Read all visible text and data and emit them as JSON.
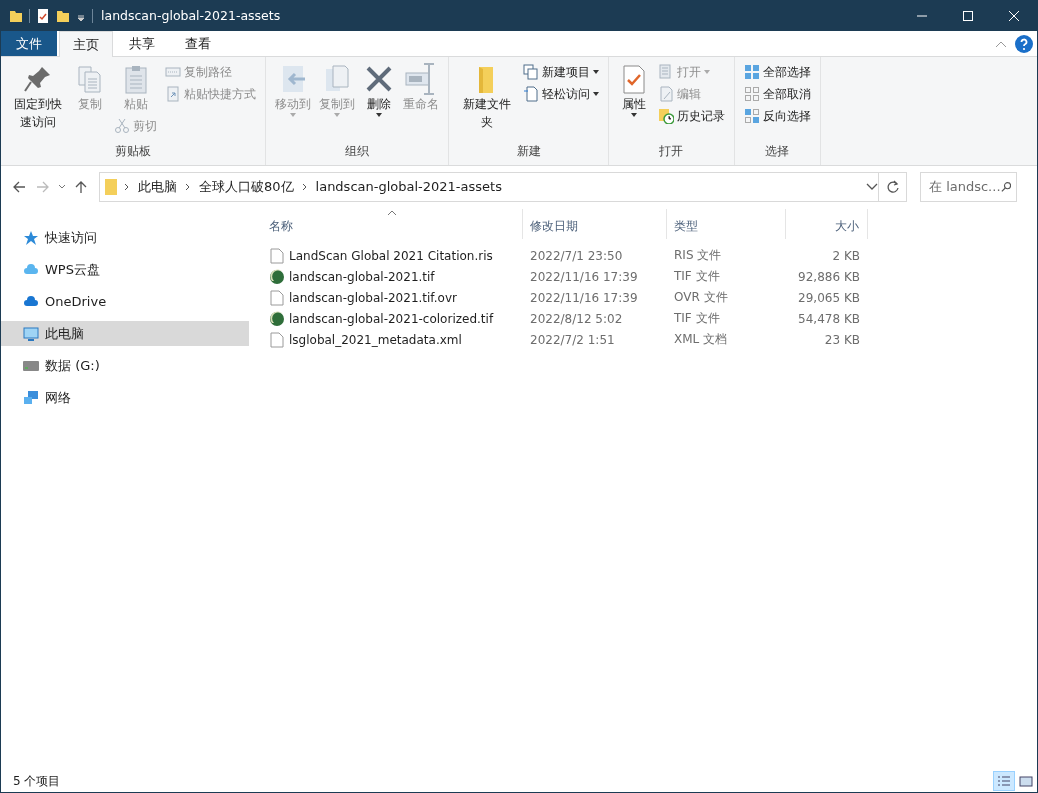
{
  "window": {
    "title": "landscan-global-2021-assets"
  },
  "ribbon_tabs": [
    {
      "label": "文件",
      "kind": "file",
      "selected": false
    },
    {
      "label": "主页",
      "kind": "tab",
      "selected": true
    },
    {
      "label": "共享",
      "kind": "tab",
      "selected": false
    },
    {
      "label": "查看",
      "kind": "tab",
      "selected": false
    }
  ],
  "ribbon_groups": [
    {
      "label": "剪贴板",
      "columns": [
        [
          {
            "label": "固定到快速访问",
            "kind": "large",
            "disabled": false
          }
        ],
        [
          {
            "label": "复制",
            "kind": "large",
            "disabled": true
          }
        ],
        [
          {
            "label": "粘贴",
            "kind": "large",
            "disabled": true
          },
          {
            "label": "剪切",
            "kind": "small",
            "disabled": true
          }
        ],
        [
          {
            "label": "复制路径",
            "kind": "small",
            "disabled": true
          },
          {
            "label": "粘贴快捷方式",
            "kind": "small",
            "disabled": true
          }
        ]
      ]
    },
    {
      "label": "组织",
      "columns": [
        [
          {
            "label": "移动到",
            "kind": "large",
            "disabled": true,
            "dropdown": true
          }
        ],
        [
          {
            "label": "复制到",
            "kind": "large",
            "disabled": true,
            "dropdown": true
          }
        ],
        [
          {
            "label": "删除",
            "kind": "large",
            "disabled": false,
            "dropdown": true
          }
        ],
        [
          {
            "label": "重命名",
            "kind": "large",
            "disabled": true
          }
        ]
      ]
    },
    {
      "label": "新建",
      "columns": [
        [
          {
            "label": "新建文件夹",
            "kind": "large",
            "disabled": false
          }
        ],
        [
          {
            "label": "新建项目",
            "kind": "small",
            "disabled": false,
            "dropdown": true
          },
          {
            "label": "轻松访问",
            "kind": "small",
            "disabled": false,
            "dropdown": true
          }
        ]
      ]
    },
    {
      "label": "打开",
      "columns": [
        [
          {
            "label": "属性",
            "kind": "large",
            "disabled": false,
            "dropdown": true
          }
        ],
        [
          {
            "label": "打开",
            "kind": "small",
            "disabled": true,
            "dropdown": true
          },
          {
            "label": "编辑",
            "kind": "small",
            "disabled": true
          },
          {
            "label": "历史记录",
            "kind": "small",
            "disabled": false
          }
        ]
      ]
    },
    {
      "label": "选择",
      "columns": [
        [
          {
            "label": "全部选择",
            "kind": "small",
            "disabled": false
          },
          {
            "label": "全部取消",
            "kind": "small",
            "disabled": false
          },
          {
            "label": "反向选择",
            "kind": "small",
            "disabled": false
          }
        ]
      ]
    }
  ],
  "address_bar": {
    "breadcrumbs": [
      "此电脑",
      "全球人口破80亿",
      "landscan-global-2021-assets"
    ],
    "search_placeholder": "在 landsc..."
  },
  "sidebar": {
    "items": [
      {
        "label": "快速访问",
        "selected": false
      },
      {
        "label": "WPS云盘",
        "selected": false
      },
      {
        "label": "OneDrive",
        "selected": false
      },
      {
        "label": "此电脑",
        "selected": true
      },
      {
        "label": "数据 (G:)",
        "selected": false
      },
      {
        "label": "网络",
        "selected": false
      }
    ]
  },
  "file_list": {
    "columns": [
      {
        "label": "名称",
        "sorted": true
      },
      {
        "label": "修改日期",
        "sorted": false
      },
      {
        "label": "类型",
        "sorted": false
      },
      {
        "label": "大小",
        "sorted": false
      }
    ],
    "rows": [
      {
        "kind": "document",
        "name": "LandScan Global 2021 Citation.ris",
        "modified": "2022/7/1 23:50",
        "type": "RIS 文件",
        "size": "2 KB"
      },
      {
        "kind": "image",
        "name": "landscan-global-2021.tif",
        "modified": "2022/11/16 17:39",
        "type": "TIF 文件",
        "size": "92,886 KB"
      },
      {
        "kind": "document",
        "name": "landscan-global-2021.tif.ovr",
        "modified": "2022/11/16 17:39",
        "type": "OVR 文件",
        "size": "29,065 KB"
      },
      {
        "kind": "image",
        "name": "landscan-global-2021-colorized.tif",
        "modified": "2022/8/12 5:02",
        "type": "TIF 文件",
        "size": "54,478 KB"
      },
      {
        "kind": "document",
        "name": "lsglobal_2021_metadata.xml",
        "modified": "2022/7/2 1:51",
        "type": "XML 文档",
        "size": "23 KB"
      }
    ]
  },
  "status_bar": {
    "item_count": "5 个项目",
    "views": [
      {
        "kind": "details",
        "selected": true
      },
      {
        "kind": "large-icons",
        "selected": false
      }
    ]
  }
}
